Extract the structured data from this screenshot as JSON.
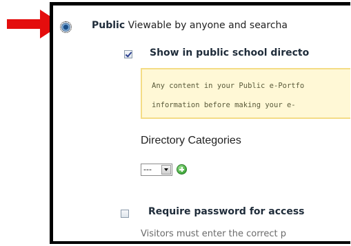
{
  "visibility": {
    "public_option": {
      "title": "Public",
      "description": " Viewable by anyone and searcha"
    },
    "directory": {
      "label": "Show in public school directo",
      "checked": true
    },
    "notice": {
      "line1": "Any content in your Public e-Portfo",
      "line2": "information before making your e-"
    },
    "categories": {
      "label": "Directory Categories",
      "selected": "---"
    },
    "password": {
      "label": "Require password for access",
      "description": "Visitors must enter the correct p",
      "checked": false
    }
  },
  "annotations": {
    "arrow_color": "#e40d0d"
  }
}
